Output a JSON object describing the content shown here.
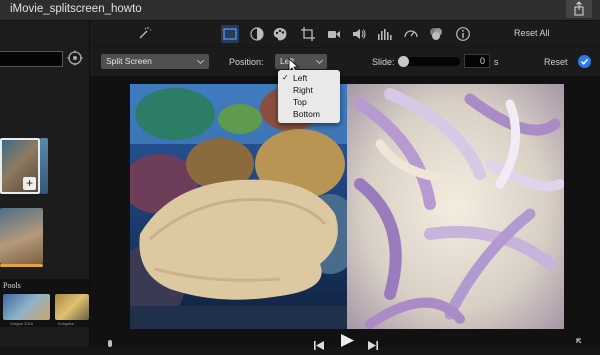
{
  "window": {
    "title": "iMovie_splitscreen_howto"
  },
  "toolbar": {
    "tools": [
      {
        "icon": "magic-wand-icon"
      },
      {
        "icon": "video-overlay-icon",
        "active": true
      },
      {
        "icon": "color-balance-icon"
      },
      {
        "icon": "color-correction-icon"
      },
      {
        "icon": "crop-icon"
      },
      {
        "icon": "stabilization-icon"
      },
      {
        "icon": "volume-icon"
      },
      {
        "icon": "equalizer-icon"
      },
      {
        "icon": "speed-icon"
      },
      {
        "icon": "clip-filter-icon"
      },
      {
        "icon": "info-icon"
      }
    ],
    "reset_all_label": "Reset All"
  },
  "controls": {
    "style_value": "Split Screen",
    "position_label": "Position:",
    "position_value": "Left",
    "slide_label": "Slide:",
    "slide_value": "0",
    "slide_unit": "s",
    "slide_fraction": 0,
    "reset_label": "Reset"
  },
  "position_menu": {
    "options": [
      {
        "label": "Left",
        "checked": true
      },
      {
        "label": "Right",
        "checked": false
      },
      {
        "label": "Top",
        "checked": false
      },
      {
        "label": "Bottom",
        "checked": false
      }
    ]
  },
  "browser": {
    "collection_title": "Pools",
    "thumb_captions": [
      "Dragon 2016",
      "Kongsbe..."
    ]
  },
  "colors": {
    "accent": "#2e7be6",
    "clip_strip": "#e8a23a"
  }
}
